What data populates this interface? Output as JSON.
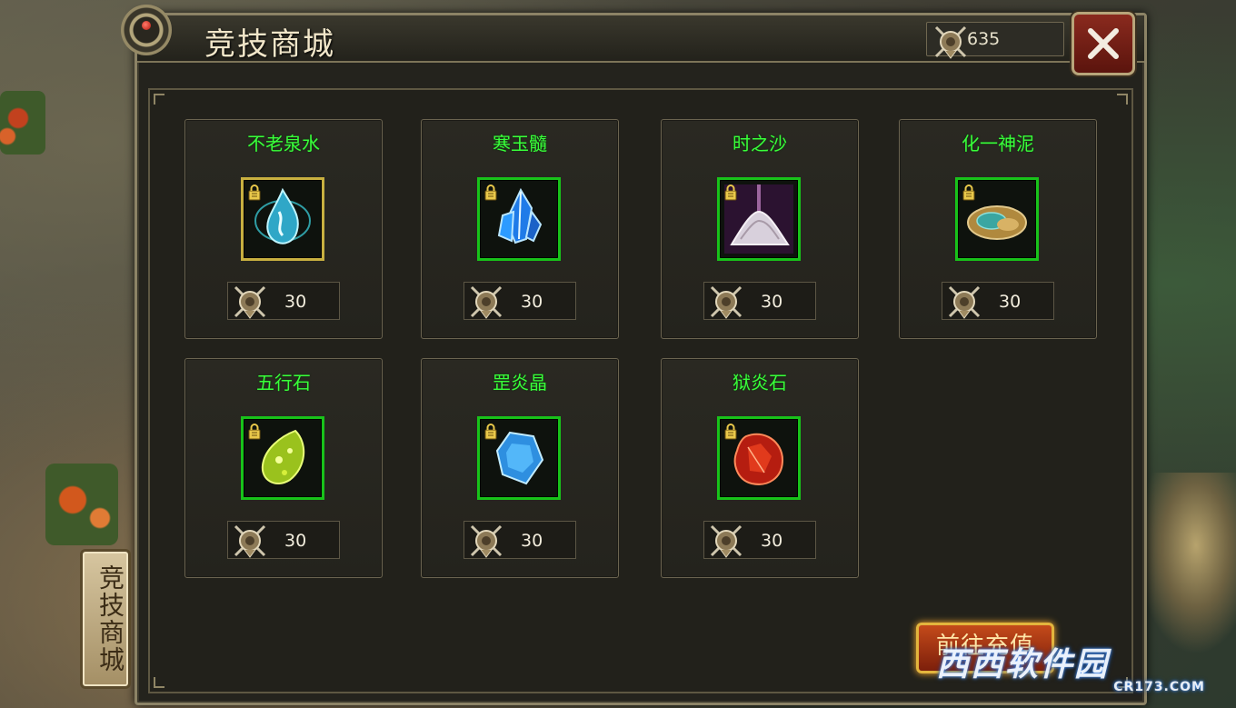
{
  "window": {
    "title": "竞技商城",
    "currency": {
      "icon": "arena-token-icon",
      "amount": "635"
    },
    "close_icon": "close-icon"
  },
  "items": [
    {
      "name": "不老泉水",
      "price": "30",
      "icon": "water-crystal-icon",
      "locked": true,
      "frame": "gold"
    },
    {
      "name": "寒玉髓",
      "price": "30",
      "icon": "blue-crystal-icon",
      "locked": true,
      "frame": "green"
    },
    {
      "name": "时之沙",
      "price": "30",
      "icon": "sand-pile-icon",
      "locked": true,
      "frame": "green"
    },
    {
      "name": "化一神泥",
      "price": "30",
      "icon": "clay-stone-icon",
      "locked": true,
      "frame": "green"
    },
    {
      "name": "五行石",
      "price": "30",
      "icon": "green-stone-icon",
      "locked": true,
      "frame": "green"
    },
    {
      "name": "罡炎晶",
      "price": "30",
      "icon": "blue-gem-icon",
      "locked": true,
      "frame": "green"
    },
    {
      "name": "狱炎石",
      "price": "30",
      "icon": "fire-stone-icon",
      "locked": true,
      "frame": "green"
    }
  ],
  "side_tab": {
    "label": "竞技商城"
  },
  "recharge_button": {
    "label": "前往充值"
  },
  "watermark": {
    "site": "西西软件园",
    "url": "CR173.COM"
  },
  "colors": {
    "item_name": "#39ff3a",
    "frame_green": "#18c21a",
    "frame_gold": "#c8b040"
  }
}
